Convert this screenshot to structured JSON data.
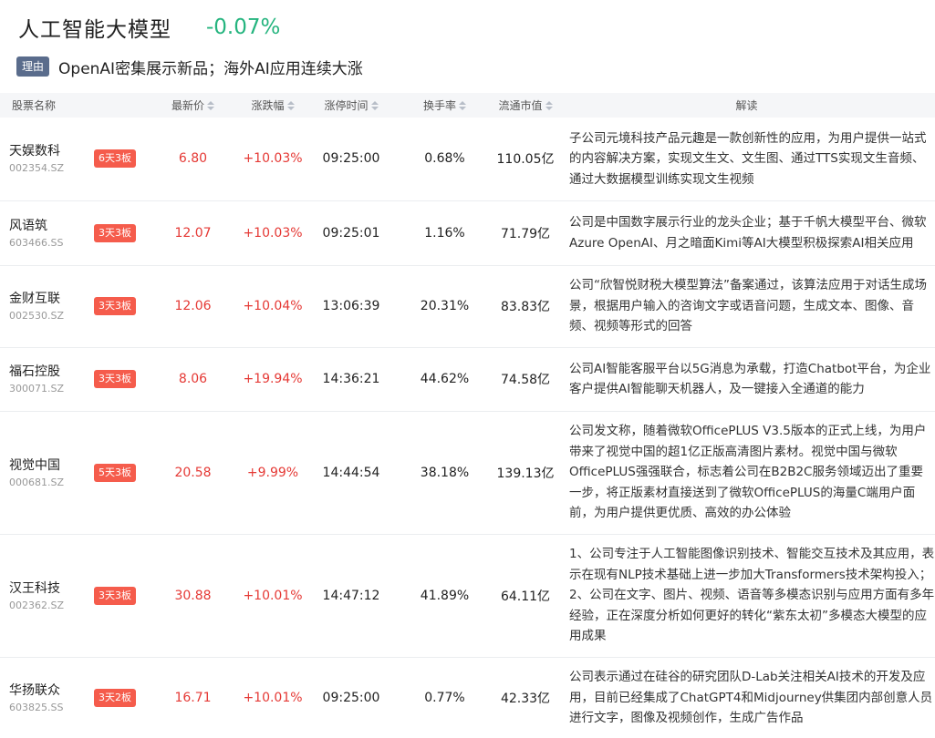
{
  "header": {
    "title": "人工智能大模型",
    "change": "-0.07%"
  },
  "reason": {
    "tag": "理由",
    "text": "OpenAI密集展示新品；海外AI应用连续大涨"
  },
  "columns": {
    "name": "股票名称",
    "price": "最新价",
    "change": "涨跌幅",
    "limit_time": "涨停时间",
    "turnover": "换手率",
    "mcap": "流通市值",
    "desc": "解读"
  },
  "rows": [
    {
      "name": "天娱数科",
      "code": "002354.SZ",
      "badge": "6天3板",
      "price": "6.80",
      "change": "+10.03%",
      "time": "09:25:00",
      "turnover": "0.68%",
      "mcap": "110.05亿",
      "desc": "子公司元境科技产品元趣是一款创新性的应用，为用户提供一站式的内容解决方案，实现文生文、文生图、通过TTS实现文生音频、通过大数据模型训练实现文生视频"
    },
    {
      "name": "风语筑",
      "code": "603466.SS",
      "badge": "3天3板",
      "price": "12.07",
      "change": "+10.03%",
      "time": "09:25:01",
      "turnover": "1.16%",
      "mcap": "71.79亿",
      "desc": "公司是中国数字展示行业的龙头企业；基于千帆大模型平台、微软Azure OpenAI、月之暗面Kimi等AI大模型积极探索AI相关应用"
    },
    {
      "name": "金财互联",
      "code": "002530.SZ",
      "badge": "3天3板",
      "price": "12.06",
      "change": "+10.04%",
      "time": "13:06:39",
      "turnover": "20.31%",
      "mcap": "83.83亿",
      "desc": "公司“欣智悦财税大模型算法”备案通过，该算法应用于对话生成场景，根据用户输入的咨询文字或语音问题，生成文本、图像、音频、视频等形式的回答"
    },
    {
      "name": "福石控股",
      "code": "300071.SZ",
      "badge": "3天3板",
      "price": "8.06",
      "change": "+19.94%",
      "time": "14:36:21",
      "turnover": "44.62%",
      "mcap": "74.58亿",
      "desc": "公司AI智能客服平台以5G消息为承载，打造Chatbot平台，为企业客户提供AI智能聊天机器人，及一键接入全通道的能力"
    },
    {
      "name": "视觉中国",
      "code": "000681.SZ",
      "badge": "5天3板",
      "price": "20.58",
      "change": "+9.99%",
      "time": "14:44:54",
      "turnover": "38.18%",
      "mcap": "139.13亿",
      "desc": "公司发文称，随着微软OfficePLUS V3.5版本的正式上线，为用户带来了视觉中国的超1亿正版高清图片素材。视觉中国与微软OfficePLUS强强联合，标志着公司在B2B2C服务领域迈出了重要一步，将正版素材直接送到了微软OfficePLUS的海量C端用户面前，为用户提供更优质、高效的办公体验"
    },
    {
      "name": "汉王科技",
      "code": "002362.SZ",
      "badge": "3天3板",
      "price": "30.88",
      "change": "+10.01%",
      "time": "14:47:12",
      "turnover": "41.89%",
      "mcap": "64.11亿",
      "desc": "1、公司专注于人工智能图像识别技术、智能交互技术及其应用，表示在现有NLP技术基础上进一步加大Transformers技术架构投入；2、公司在文字、图片、视频、语音等多模态识别与应用方面有多年经验，正在深度分析如何更好的转化“紫东太初”多模态大模型的应用成果"
    },
    {
      "name": "华扬联众",
      "code": "603825.SS",
      "badge": "3天2板",
      "price": "16.71",
      "change": "+10.01%",
      "time": "09:25:00",
      "turnover": "0.77%",
      "mcap": "42.33亿",
      "desc": "公司表示通过在硅谷的研究团队D-Lab关注相关AI技术的开发及应用，目前已经集成了ChatGPT4和Midjourney供集团内部创意人员进行文字，图像及视频创作，生成广告作品"
    }
  ]
}
